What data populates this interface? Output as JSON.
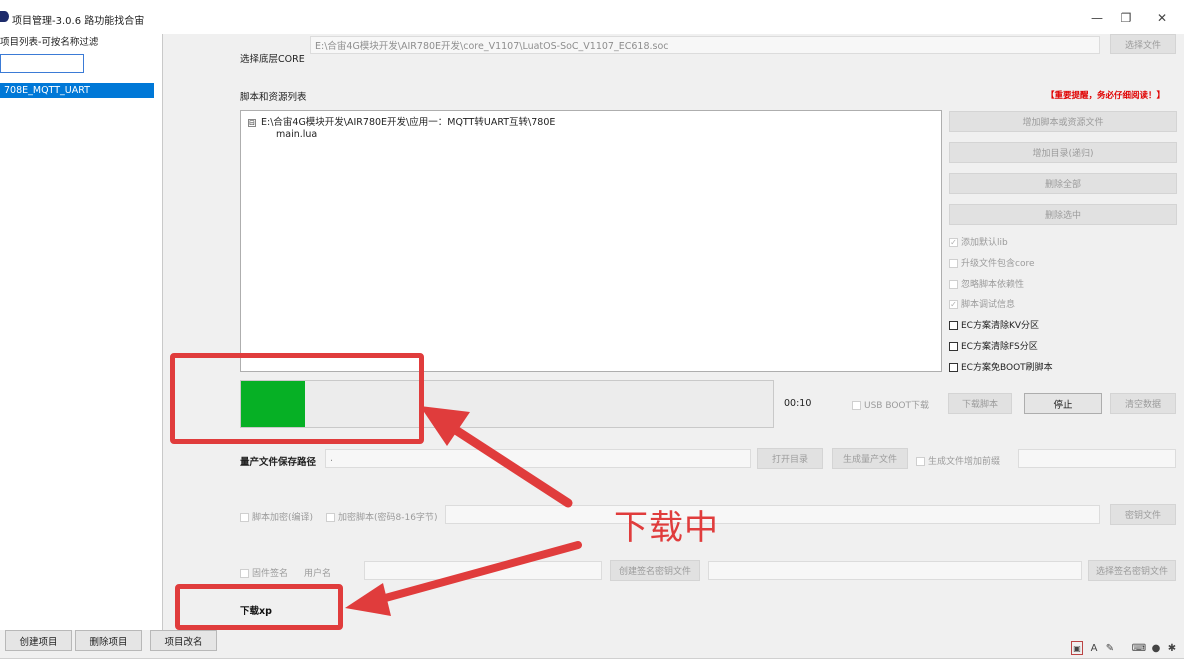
{
  "window": {
    "title": "项目管理-3.0.6 路功能找合宙",
    "minimize_glyph": "—",
    "maximize_glyph": "❐",
    "close_glyph": "✕"
  },
  "left": {
    "project_list_label": "项目列表-可按名称过滤",
    "filter_value": "",
    "projects": [
      "708E_MQTT_UART"
    ],
    "buttons": {
      "create": "创建项目",
      "delete": "删除项目",
      "rename": "项目改名"
    }
  },
  "core": {
    "label": "选择底层CORE",
    "path": "E:\\合宙4G模块开发\\AIR780E开发\\core_V1107\\LuatOS-SoC_V1107_EC618.soc",
    "select_button": "选择文件"
  },
  "scripts": {
    "label": "脚本和资源列表",
    "important_notice": "【重要提醒，务必仔细阅读！】",
    "tree_root": "E:\\合宙4G模块开发\\AIR780E开发\\应用一：MQTT转UART互转\\780E",
    "tree_expander": "⊟",
    "tree_child": "main.lua",
    "buttons": {
      "add_files": "增加脚本或资源文件",
      "add_dir": "增加目录(递归)",
      "delete_all": "删除全部",
      "delete_selected": "删除选中"
    },
    "options": [
      {
        "label": "添加默认lib",
        "checked": true,
        "enabled": false
      },
      {
        "label": "升级文件包含core",
        "checked": false,
        "enabled": false
      },
      {
        "label": "忽略脚本依赖性",
        "checked": false,
        "enabled": false
      },
      {
        "label": "脚本调试信息",
        "checked": true,
        "enabled": false
      },
      {
        "label": "EC方案清除KV分区",
        "checked": false,
        "enabled": true
      },
      {
        "label": "EC方案清除FS分区",
        "checked": false,
        "enabled": true
      },
      {
        "label": "EC方案免BOOT刷脚本",
        "checked": false,
        "enabled": true
      }
    ]
  },
  "download": {
    "progress": 0.12,
    "elapsed": "00:10",
    "usb_boot_label": "USB BOOT下载",
    "download_script_button": "下载脚本",
    "stop_button": "停止",
    "clear_button": "清空数据"
  },
  "mass_production": {
    "label": "量产文件保存路径",
    "path_value": ".",
    "open_dir_button": "打开目录",
    "generate_button": "生成量产文件",
    "gen_note_label": "生成文件增加前缀",
    "prefix_value": ""
  },
  "encrypt": {
    "script_encrypt_label": "脚本加密(编译)",
    "encrypt_key_label": "加密脚本(密码8-16字节)",
    "key_value": "",
    "browse_button": "密钥文件"
  },
  "firmware_sign": {
    "label": "固件签名",
    "user_placeholder": "用户名",
    "sign_button": "创建签名密钥文件",
    "export_button": "选择签名密钥文件"
  },
  "status": {
    "text": "下载xp"
  },
  "annotation": {
    "label": "下载中",
    "color": "#e03c3c"
  },
  "statusbar_icons": [
    "image-icon",
    "font-icon",
    "pen-icon",
    "keyboard-icon",
    "user-icon",
    "settings-icon"
  ]
}
